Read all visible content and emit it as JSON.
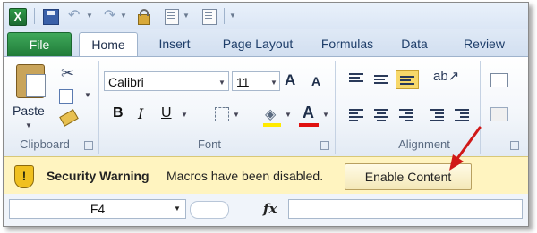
{
  "quick_access": {
    "app_icon": "excel-icon",
    "buttons": [
      "save-icon",
      "undo-icon",
      "redo-icon",
      "lock-icon",
      "sheet-icon",
      "sheet-icon"
    ]
  },
  "tabs": {
    "file": "File",
    "items": [
      "Home",
      "Insert",
      "Page Layout",
      "Formulas",
      "Data",
      "Review"
    ],
    "active": "Home"
  },
  "ribbon": {
    "clipboard": {
      "label": "Clipboard",
      "paste_label": "Paste"
    },
    "font": {
      "label": "Font",
      "font_name": "Calibri",
      "font_size": "11",
      "grow": "A",
      "shrink": "A",
      "bold": "B",
      "italic": "I",
      "underline": "U"
    },
    "alignment": {
      "label": "Alignment"
    }
  },
  "security_bar": {
    "title": "Security Warning",
    "message": "Macros have been disabled.",
    "button": "Enable Content",
    "colors": {
      "background": "#fff4c0",
      "arrow": "#d01818"
    }
  },
  "formula_bar": {
    "cell_ref": "F4",
    "fx": "fx",
    "formula": ""
  }
}
